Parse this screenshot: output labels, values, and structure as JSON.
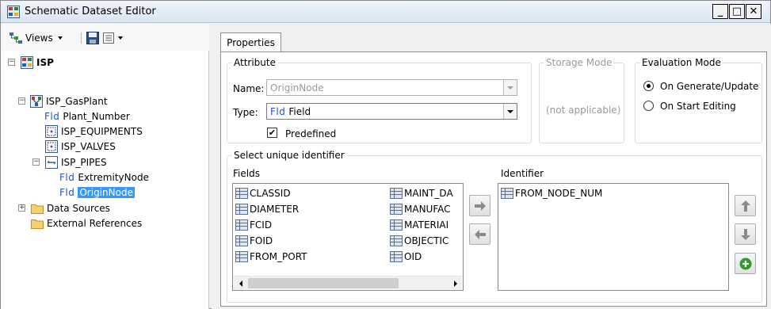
{
  "window": {
    "title": "Schematic Dataset Editor",
    "controls": {
      "minimize": "_",
      "maximize": "□",
      "close": "✕"
    }
  },
  "toolbar": {
    "views_label": "Views",
    "icons": [
      "views-icon",
      "save-icon",
      "list-options-icon"
    ]
  },
  "tree": {
    "expander_collapsed": "+",
    "expander_expanded": "−",
    "fld_tag": "Fld",
    "root": "ISP",
    "gasplant": "ISP_GasPlant",
    "plant_number": "Plant_Number",
    "equipments": "ISP_EQUIPMENTS",
    "valves": "ISP_VALVES",
    "pipes": "ISP_PIPES",
    "extremity_node": "ExtremityNode",
    "origin_node": "OriginNode",
    "data_sources": "Data Sources",
    "external_references": "External References"
  },
  "tabs": {
    "properties": "Properties"
  },
  "attribute": {
    "legend": "Attribute",
    "name_label": "Name:",
    "name_value": "OriginNode",
    "type_label": "Type:",
    "type_prefix": "Fld",
    "type_value": "Field",
    "predefined_label": "Predefined",
    "predefined_checked": true
  },
  "storage_mode": {
    "legend": "Storage Mode",
    "value": "(not applicable)"
  },
  "evaluation_mode": {
    "legend": "Evaluation Mode",
    "options": [
      "On Generate/Update",
      "On Start Editing"
    ],
    "selected": "On Generate/Update"
  },
  "unique_identifier": {
    "legend": "Select unique identifier",
    "fields_label": "Fields",
    "identifier_label": "Identifier",
    "fields_col1": [
      "CLASSID",
      "DIAMETER",
      "FCID",
      "FOID",
      "FROM_PORT"
    ],
    "fields_col2": [
      "MAINT_DA",
      "MANUFAC",
      "MATERIAI",
      "OBJECTIC",
      "OID"
    ],
    "identifier_items": [
      "FROM_NODE_NUM"
    ]
  },
  "colors": {
    "accent": "#3399ff",
    "fld_blue": "#1e50d6",
    "add_green": "#2e9b2e"
  }
}
